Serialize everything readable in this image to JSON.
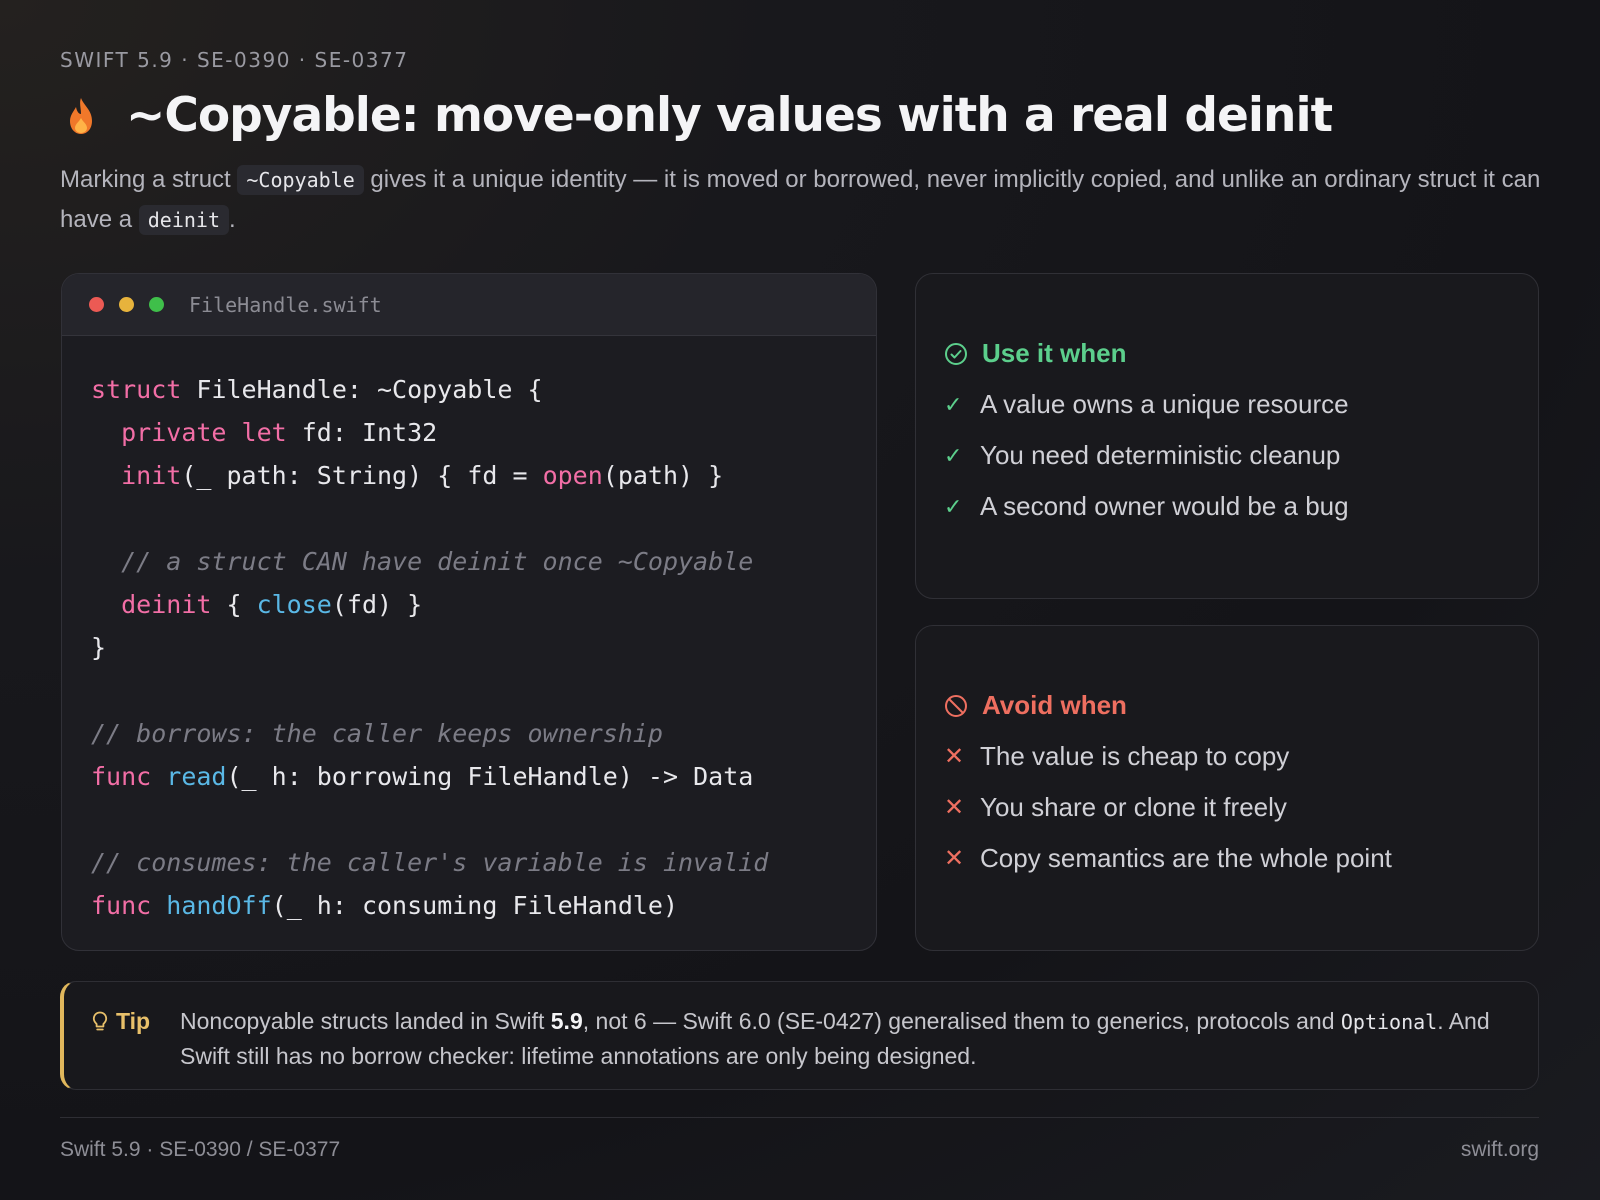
{
  "header": {
    "eyebrow": "SWIFT 5.9 · SE-0390 · SE-0377",
    "title": "~Copyable: move-only values with a real deinit",
    "icon": "flame-icon"
  },
  "lede": {
    "part1": "Marking a struct ",
    "code1": "~Copyable",
    "part2": " gives it a unique identity — it is moved or borrowed, never implicitly copied, and unlike an ordinary struct it can have a ",
    "code2": "deinit",
    "part3": "."
  },
  "code_card": {
    "filename": "FileHandle.swift",
    "lines": [
      [
        {
          "t": "struct",
          "c": "kw"
        },
        {
          "t": " FileHandle: ~Copyable {",
          "c": ""
        }
      ],
      [
        {
          "t": "  ",
          "c": ""
        },
        {
          "t": "private",
          "c": "kw"
        },
        {
          "t": " ",
          "c": ""
        },
        {
          "t": "let",
          "c": "kw"
        },
        {
          "t": " fd: Int32",
          "c": ""
        }
      ],
      [
        {
          "t": "  ",
          "c": ""
        },
        {
          "t": "init",
          "c": "kw"
        },
        {
          "t": "(_ path: String) { fd = ",
          "c": ""
        },
        {
          "t": "open",
          "c": "kw"
        },
        {
          "t": "(path) }",
          "c": ""
        }
      ],
      [],
      [
        {
          "t": "  ",
          "c": ""
        },
        {
          "t": "// a struct CAN have deinit once ~Copyable",
          "c": "cm"
        }
      ],
      [
        {
          "t": "  ",
          "c": ""
        },
        {
          "t": "deinit",
          "c": "kw"
        },
        {
          "t": " { ",
          "c": ""
        },
        {
          "t": "close",
          "c": "fn"
        },
        {
          "t": "(fd) }",
          "c": ""
        }
      ],
      [
        {
          "t": "}",
          "c": ""
        }
      ],
      [],
      [
        {
          "t": "// borrows: the caller keeps ownership",
          "c": "cm"
        }
      ],
      [
        {
          "t": "func",
          "c": "kw"
        },
        {
          "t": " ",
          "c": ""
        },
        {
          "t": "read",
          "c": "fn"
        },
        {
          "t": "(_ h: borrowing FileHandle) -> Data",
          "c": ""
        }
      ],
      [],
      [
        {
          "t": "// consumes: the caller's variable is invalid",
          "c": "cm"
        }
      ],
      [
        {
          "t": "func",
          "c": "kw"
        },
        {
          "t": " ",
          "c": ""
        },
        {
          "t": "handOff",
          "c": "fn"
        },
        {
          "t": "(_ h: consuming FileHandle)",
          "c": ""
        }
      ]
    ]
  },
  "use_card": {
    "title": "Use it when",
    "items": [
      "A value owns a unique resource",
      "You need deterministic cleanup",
      "A second owner would be a bug"
    ]
  },
  "avoid_card": {
    "title": "Avoid when",
    "items": [
      "The value is cheap to copy",
      "You share or clone it freely",
      "Copy semantics are the whole point"
    ]
  },
  "tip": {
    "label": "Tip",
    "t1": "Noncopyable structs landed in Swift ",
    "b1": "5.9",
    "t2": ", not 6 — Swift 6.0 (SE-0427) generalised them to generics, protocols and ",
    "code": "Optional",
    "t3": ". And Swift still has no borrow checker: lifetime annotations are only being designed."
  },
  "footer": {
    "left": "Swift 5.9 · SE-0390 / SE-0377",
    "right": "swift.org"
  },
  "colors": {
    "keyword": "#f26ea6",
    "function": "#5ab8e6",
    "comment": "#7c7c86",
    "use_green": "#5ccf8c",
    "avoid_red": "#ee6f60",
    "tip_gold": "#e0b75c"
  }
}
